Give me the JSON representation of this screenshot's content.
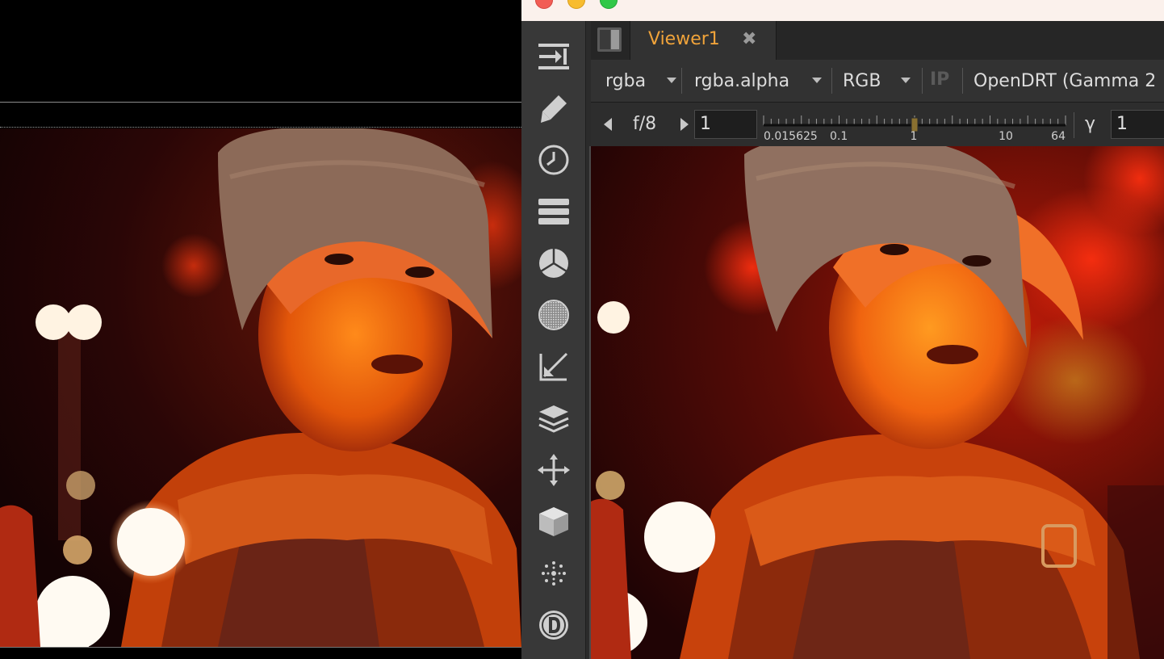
{
  "window": {
    "tab_title": "Viewer1",
    "tab_close_glyph": "✖"
  },
  "toolbar": {
    "tools": [
      {
        "icon": "input-arrow-icon"
      },
      {
        "icon": "paint-brush-icon"
      },
      {
        "icon": "clock-icon"
      },
      {
        "icon": "channel-layers-icon"
      },
      {
        "icon": "color-wheel-icon"
      },
      {
        "icon": "filter-sphere-icon"
      },
      {
        "icon": "keyer-icon"
      },
      {
        "icon": "merge-stack-icon"
      },
      {
        "icon": "transform-icon"
      },
      {
        "icon": "3d-cube-icon"
      },
      {
        "icon": "particles-icon"
      },
      {
        "icon": "deep-icon"
      }
    ]
  },
  "channels": {
    "layer": "rgba",
    "alpha_channel": "rgba.alpha",
    "display_channels": "RGB",
    "input_process": "IP",
    "viewer_process": "OpenDRT (Gamma 2"
  },
  "exposure": {
    "fstop_label": "f/8",
    "gain_value": "1",
    "gain_fraction": 0.5,
    "slider_ticks": [
      "0.015625",
      "0.1",
      "1",
      "10",
      "64"
    ],
    "gamma_label": "γ",
    "gamma_value": "1"
  },
  "colors": {
    "tab_label": "#f0a33a",
    "toolbar_bg": "#383838",
    "title_bar_bg": "#fbf1ec"
  }
}
